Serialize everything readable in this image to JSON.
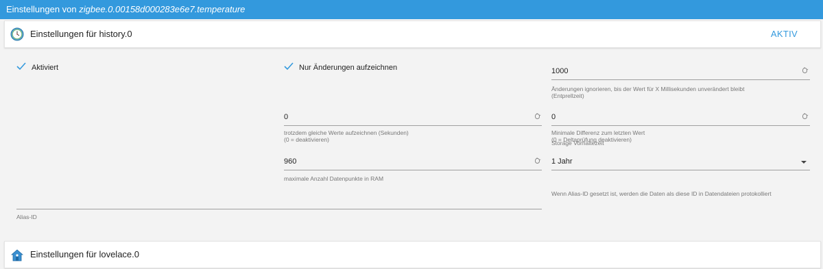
{
  "window": {
    "title_prefix": "Einstellungen von ",
    "object_id": "zigbee.0.00158d000283e6e7.temperature"
  },
  "history_panel": {
    "title": "Einstellungen für history.0",
    "status": "AKTIV",
    "enabled": {
      "label": "Aktiviert",
      "checked": true
    },
    "only_changes": {
      "label": "Nur Änderungen aufzeichnen",
      "checked": true
    },
    "debounce": {
      "value": "1000",
      "helper_line1": "Änderungen ignorieren, bis der Wert für X Millisekunden unverändert bleibt",
      "helper_line2": "(Entprellzeit)"
    },
    "record_same": {
      "value": "0",
      "helper_line1": "trotzdem gleiche Werte aufzeichnen (Sekunden)",
      "helper_line2": "(0 = deaktivieren)"
    },
    "min_diff": {
      "value": "0",
      "helper_line1": "Minimale Differenz zum letzten Wert",
      "helper_line2": "(0 = Deltaprüfung deaktivieren)"
    },
    "max_ram": {
      "value": "960",
      "helper_line1": "maximale Anzahl Datenpunkte in RAM"
    },
    "storage": {
      "label": "Storage Vorhaltezeit",
      "value": "1 Jahr"
    },
    "alias": {
      "value": "",
      "label": "Alias-ID",
      "hint": "Wenn Alias-ID gesetzt ist, werden die Daten als diese ID in Datendateien protokolliert"
    }
  },
  "lovelace_panel": {
    "title": "Einstellungen für lovelace.0"
  },
  "colors": {
    "accent": "#3399dd",
    "panel_bg": "#f3f3f3"
  },
  "icons": {
    "history": "clock-icon",
    "lovelace": "house-icon",
    "check": "checkmark-icon"
  }
}
